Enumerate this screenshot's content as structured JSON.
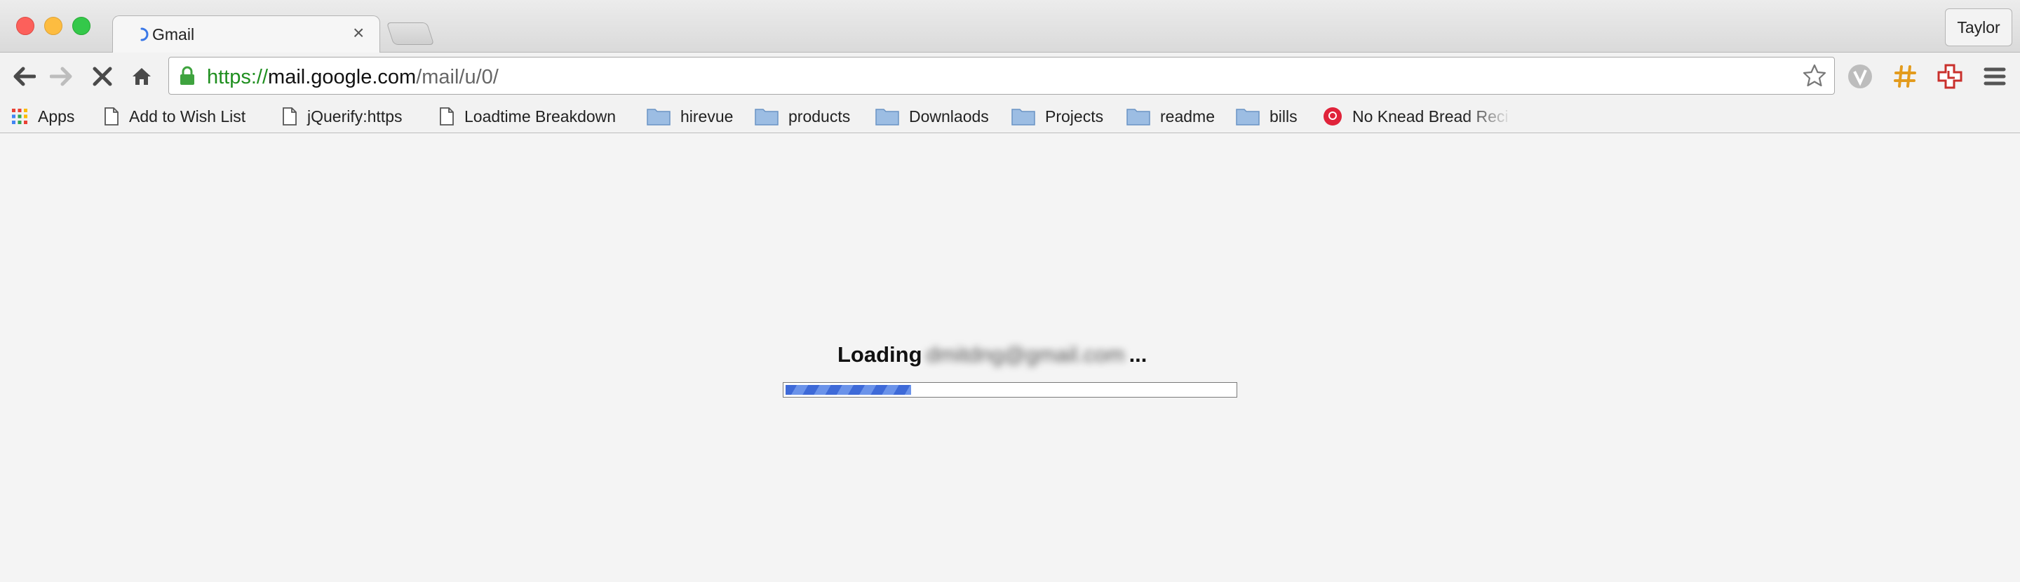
{
  "window": {
    "tab_title": "Gmail",
    "tab_close_glyph": "×",
    "profile_name": "Taylor"
  },
  "toolbar": {
    "url_scheme": "https://",
    "url_host": "mail.google.com",
    "url_path": "/mail/u/0/"
  },
  "bookmarks": [
    {
      "label": "Apps",
      "icon": "apps-grid-icon"
    },
    {
      "label": "Add to Wish List",
      "icon": "page-icon"
    },
    {
      "label": "jQuerify:https",
      "icon": "page-icon"
    },
    {
      "label": "Loadtime Breakdown",
      "icon": "page-icon"
    },
    {
      "label": "hirevue",
      "icon": "folder-icon"
    },
    {
      "label": "products",
      "icon": "folder-icon"
    },
    {
      "label": "Downlaods",
      "icon": "folder-icon"
    },
    {
      "label": "Projects",
      "icon": "folder-icon"
    },
    {
      "label": "readme",
      "icon": "folder-icon"
    },
    {
      "label": "bills",
      "icon": "folder-icon"
    },
    {
      "label": "No Knead Bread Reci",
      "icon": "favicon-red-icon"
    }
  ],
  "content": {
    "loading_prefix": "Loading",
    "email": "dmitdng@gmail.com",
    "loading_suffix": "...",
    "progress_fraction": 0.28
  },
  "colors": {
    "accent": "#3e6ad8",
    "url_scheme": "#1f8f1f"
  }
}
